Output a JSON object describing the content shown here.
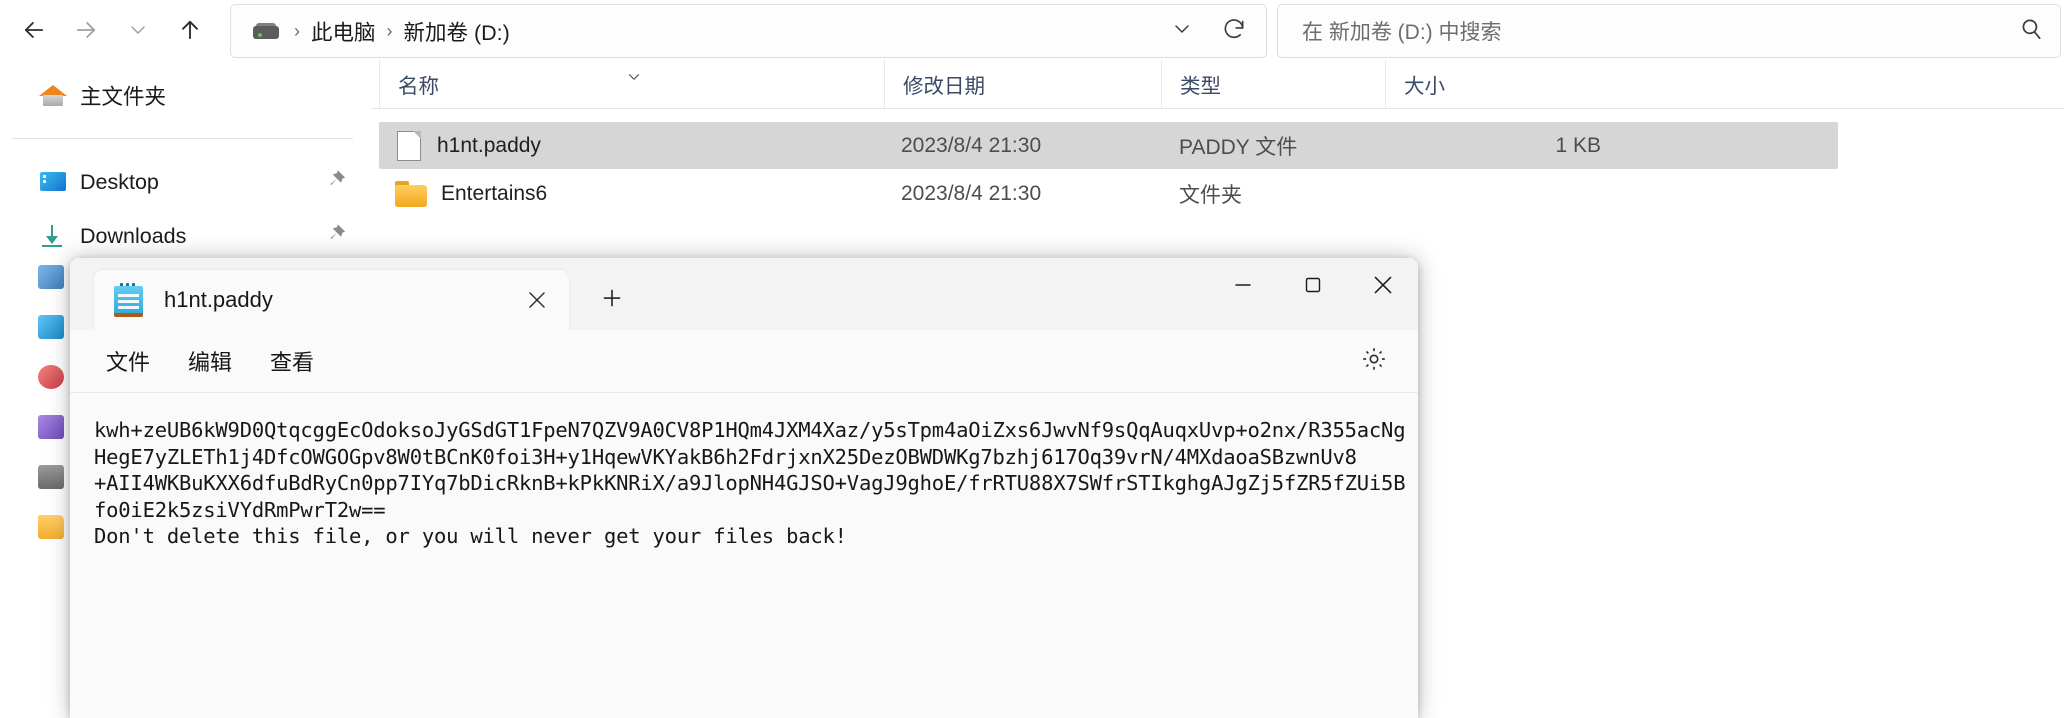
{
  "explorer": {
    "nav": {
      "back_icon": "arrow-left-icon",
      "forward_icon": "arrow-right-icon",
      "recent_icon": "chevron-down-icon",
      "up_icon": "arrow-up-icon"
    },
    "address": {
      "drive_icon": "drive-icon",
      "crumbs": [
        "此电脑",
        "新加卷 (D:)"
      ],
      "separator": "›",
      "dropdown_icon": "chevron-down-icon",
      "refresh_icon": "refresh-icon"
    },
    "search": {
      "placeholder": "在 新加卷 (D:) 中搜索",
      "icon": "search-icon"
    },
    "sidebar": {
      "home": {
        "label": "主文件夹",
        "icon": "home-icon"
      },
      "items": [
        {
          "label": "Desktop",
          "icon": "desktop-icon",
          "pinned": true
        },
        {
          "label": "Downloads",
          "icon": "downloads-icon",
          "pinned": true
        }
      ],
      "pin_icon": "pin-icon"
    },
    "columns": [
      {
        "label": "名称",
        "sorted": true,
        "sort_icon": "chevron-up-icon"
      },
      {
        "label": "修改日期",
        "sorted": false
      },
      {
        "label": "类型",
        "sorted": false
      },
      {
        "label": "大小",
        "sorted": false
      }
    ],
    "rows": [
      {
        "name": "h1nt.paddy",
        "date": "2023/8/4 21:30",
        "type": "PADDY 文件",
        "size": "1 KB",
        "icon": "file-icon",
        "selected": true
      },
      {
        "name": "Entertains6",
        "date": "2023/8/4 21:30",
        "type": "文件夹",
        "size": "",
        "icon": "folder-icon",
        "selected": false
      }
    ]
  },
  "notepad": {
    "app_icon": "notepad-icon",
    "tab": {
      "title": "h1nt.paddy",
      "close_icon": "close-icon"
    },
    "new_tab_icon": "plus-icon",
    "window_controls": {
      "minimize": "minimize-icon",
      "maximize": "maximize-icon",
      "close": "close-icon"
    },
    "menus": [
      "文件",
      "编辑",
      "查看"
    ],
    "settings_icon": "gear-icon",
    "content": "kwh+zeUB6kW9D0QtqcggEcOdoksoJyGSdGT1FpeN7QZV9A0CV8P1HQm4JXM4Xaz/y5sTpm4aOiZxs6JwvNf9sQqAuqxUvp+o2nx/R355acNg\nHegE7yZLETh1j4DfcOWGOGpv8W0tBCnK0foi3H+y1HqewVKYakB6h2FdrjxnX25DezOBWDWKg7bzhj617Oq39vrN/4MXdaoaSBzwnUv8\n+AII4WKBuKXX6dfuBdRyCn0pp7IYq7bDicRknB+kPkKNRiX/a9JlopNH4GJSO+VagJ9ghoE/frRTU88X7SWfrSTIkghgAJgZj5fZR5fZUi5B\nfo0iE2k5zsiVYdRmPwrT2w==\nDon't delete this file, or you will never get your files back!"
  }
}
